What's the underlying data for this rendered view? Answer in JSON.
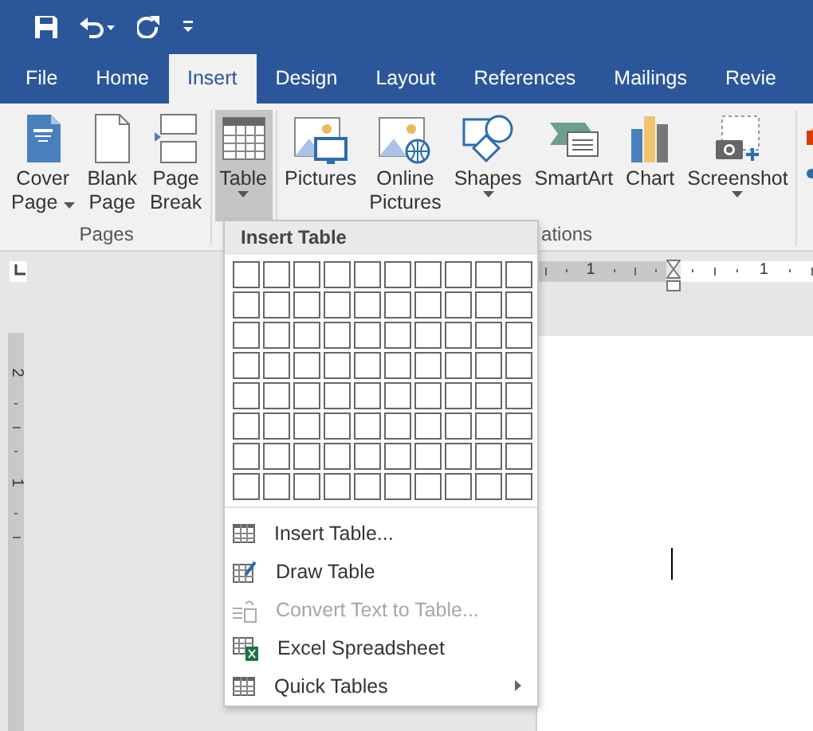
{
  "tabs": [
    {
      "label": "File",
      "selected": false
    },
    {
      "label": "Home",
      "selected": false
    },
    {
      "label": "Insert",
      "selected": true
    },
    {
      "label": "Design",
      "selected": false
    },
    {
      "label": "Layout",
      "selected": false
    },
    {
      "label": "References",
      "selected": false
    },
    {
      "label": "Mailings",
      "selected": false
    },
    {
      "label": "Revie",
      "selected": false
    }
  ],
  "ribbon": {
    "groups": [
      {
        "label": "Pages",
        "buttons": [
          {
            "kind": "cover",
            "lines": [
              "Cover",
              "Page"
            ],
            "dropdown": true,
            "selected": false
          },
          {
            "kind": "blank",
            "lines": [
              "Blank",
              "Page"
            ],
            "dropdown": false,
            "selected": false
          },
          {
            "kind": "break",
            "lines": [
              "Page",
              "Break"
            ],
            "dropdown": false,
            "selected": false
          }
        ]
      },
      {
        "buttons": [
          {
            "kind": "table",
            "lines": [
              "Table"
            ],
            "dropdown": true,
            "selected": true
          }
        ]
      },
      {
        "label": "ations",
        "buttons": [
          {
            "kind": "pictures",
            "lines": [
              "Pictures"
            ],
            "dropdown": false,
            "selected": false
          },
          {
            "kind": "online",
            "lines": [
              "Online",
              "Pictures"
            ],
            "dropdown": false,
            "selected": false
          },
          {
            "kind": "shapes",
            "lines": [
              "Shapes"
            ],
            "dropdown": true,
            "selected": false
          },
          {
            "kind": "smartart",
            "lines": [
              "SmartArt"
            ],
            "dropdown": false,
            "selected": false
          },
          {
            "kind": "chart",
            "lines": [
              "Chart"
            ],
            "dropdown": false,
            "selected": false
          },
          {
            "kind": "screenshot",
            "lines": [
              "Screenshot"
            ],
            "dropdown": true,
            "selected": false
          }
        ]
      }
    ]
  },
  "ruler": {
    "horizontal_numbers": [
      "1",
      "1"
    ],
    "vertical_numbers": [
      "2",
      "1"
    ]
  },
  "menu": {
    "title": "Insert Table",
    "grid": [
      [
        {
          "selected": false
        },
        {
          "selected": false
        },
        {
          "selected": false
        },
        {
          "selected": false
        },
        {
          "selected": false
        },
        {
          "selected": false
        },
        {
          "selected": false
        },
        {
          "selected": false
        },
        {
          "selected": false
        },
        {
          "selected": false
        }
      ],
      [
        {
          "selected": false
        },
        {
          "selected": false
        },
        {
          "selected": false
        },
        {
          "selected": false
        },
        {
          "selected": false
        },
        {
          "selected": false
        },
        {
          "selected": false
        },
        {
          "selected": false
        },
        {
          "selected": false
        },
        {
          "selected": false
        }
      ],
      [
        {
          "selected": false
        },
        {
          "selected": false
        },
        {
          "selected": false
        },
        {
          "selected": false
        },
        {
          "selected": false
        },
        {
          "selected": false
        },
        {
          "selected": false
        },
        {
          "selected": false
        },
        {
          "selected": false
        },
        {
          "selected": false
        }
      ],
      [
        {
          "selected": false
        },
        {
          "selected": false
        },
        {
          "selected": false
        },
        {
          "selected": false
        },
        {
          "selected": false
        },
        {
          "selected": false
        },
        {
          "selected": false
        },
        {
          "selected": false
        },
        {
          "selected": false
        },
        {
          "selected": false
        }
      ],
      [
        {
          "selected": false
        },
        {
          "selected": false
        },
        {
          "selected": false
        },
        {
          "selected": false
        },
        {
          "selected": false
        },
        {
          "selected": false
        },
        {
          "selected": false
        },
        {
          "selected": false
        },
        {
          "selected": false
        },
        {
          "selected": false
        }
      ],
      [
        {
          "selected": false
        },
        {
          "selected": false
        },
        {
          "selected": false
        },
        {
          "selected": false
        },
        {
          "selected": false
        },
        {
          "selected": false
        },
        {
          "selected": false
        },
        {
          "selected": false
        },
        {
          "selected": false
        },
        {
          "selected": false
        }
      ],
      [
        {
          "selected": false
        },
        {
          "selected": false
        },
        {
          "selected": false
        },
        {
          "selected": false
        },
        {
          "selected": false
        },
        {
          "selected": false
        },
        {
          "selected": false
        },
        {
          "selected": false
        },
        {
          "selected": false
        },
        {
          "selected": false
        }
      ],
      [
        {
          "selected": false
        },
        {
          "selected": false
        },
        {
          "selected": false
        },
        {
          "selected": false
        },
        {
          "selected": false
        },
        {
          "selected": false
        },
        {
          "selected": false
        },
        {
          "selected": false
        },
        {
          "selected": false
        },
        {
          "selected": false
        }
      ]
    ],
    "items": [
      {
        "kind": "insert",
        "label": "Insert Table...",
        "disabled": false,
        "submenu": false
      },
      {
        "kind": "draw",
        "label": "Draw Table",
        "disabled": false,
        "submenu": false
      },
      {
        "kind": "convert",
        "label": "Convert Text to Table...",
        "disabled": true,
        "submenu": false
      },
      {
        "kind": "excel",
        "label": "Excel Spreadsheet",
        "disabled": false,
        "submenu": false
      },
      {
        "kind": "quick",
        "label": "Quick Tables",
        "disabled": false,
        "submenu": true
      }
    ]
  }
}
